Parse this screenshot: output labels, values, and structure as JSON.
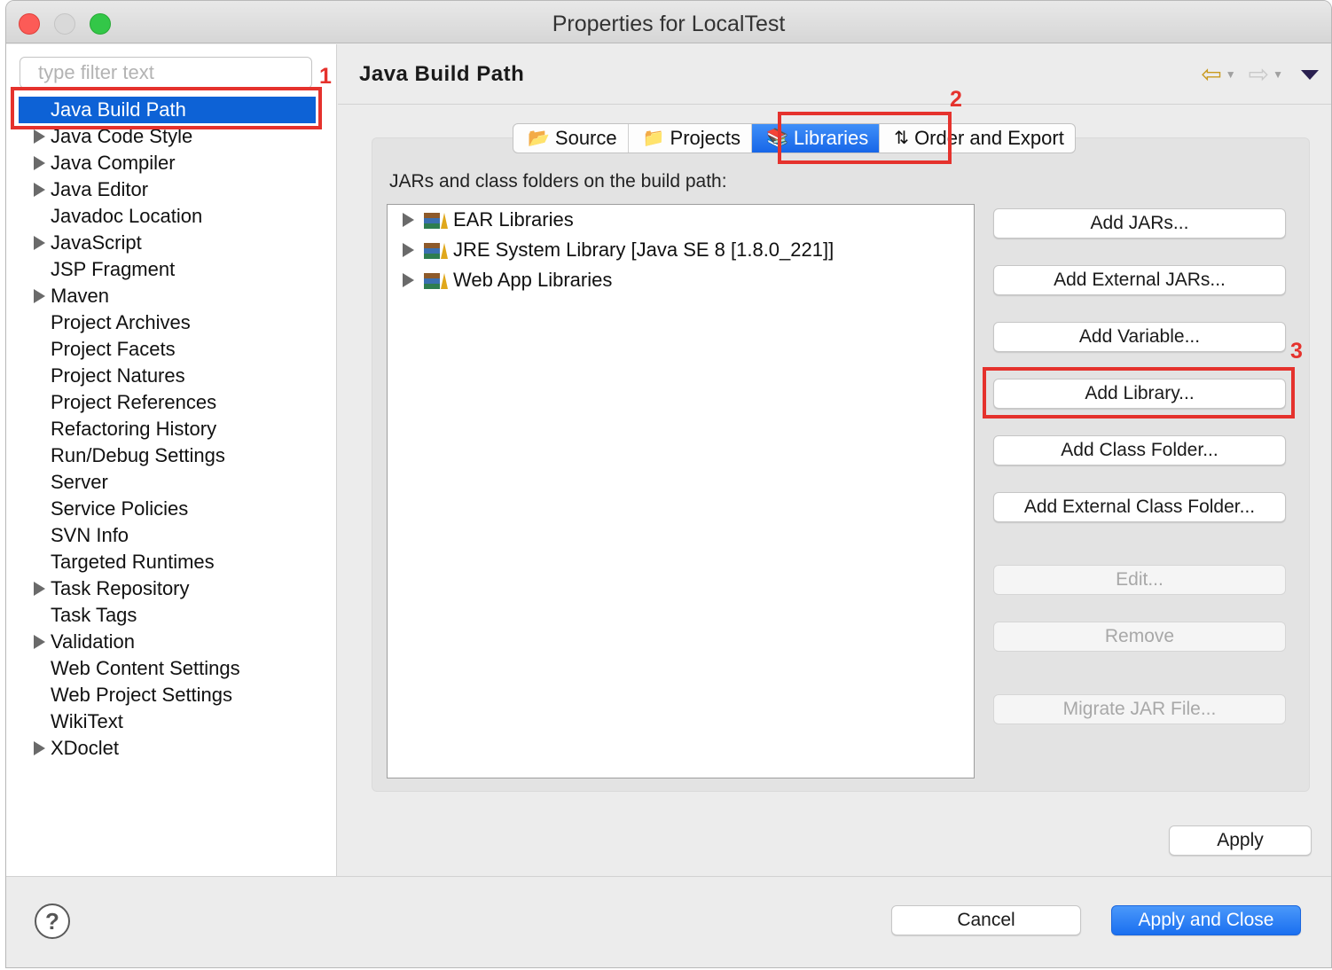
{
  "window": {
    "title": "Properties for LocalTest"
  },
  "filter": {
    "placeholder": "type filter text"
  },
  "tree": [
    {
      "label": "Java Build Path",
      "expandable": false,
      "selected": true
    },
    {
      "label": "Java Code Style",
      "expandable": true
    },
    {
      "label": "Java Compiler",
      "expandable": true
    },
    {
      "label": "Java Editor",
      "expandable": true
    },
    {
      "label": "Javadoc Location",
      "expandable": false
    },
    {
      "label": "JavaScript",
      "expandable": true
    },
    {
      "label": "JSP Fragment",
      "expandable": false
    },
    {
      "label": "Maven",
      "expandable": true
    },
    {
      "label": "Project Archives",
      "expandable": false
    },
    {
      "label": "Project Facets",
      "expandable": false
    },
    {
      "label": "Project Natures",
      "expandable": false
    },
    {
      "label": "Project References",
      "expandable": false
    },
    {
      "label": "Refactoring History",
      "expandable": false
    },
    {
      "label": "Run/Debug Settings",
      "expandable": false
    },
    {
      "label": "Server",
      "expandable": false
    },
    {
      "label": "Service Policies",
      "expandable": false
    },
    {
      "label": "SVN Info",
      "expandable": false
    },
    {
      "label": "Targeted Runtimes",
      "expandable": false
    },
    {
      "label": "Task Repository",
      "expandable": true
    },
    {
      "label": "Task Tags",
      "expandable": false
    },
    {
      "label": "Validation",
      "expandable": true
    },
    {
      "label": "Web Content Settings",
      "expandable": false
    },
    {
      "label": "Web Project Settings",
      "expandable": false
    },
    {
      "label": "WikiText",
      "expandable": false
    },
    {
      "label": "XDoclet",
      "expandable": true
    }
  ],
  "page": {
    "title": "Java Build Path"
  },
  "tabs": [
    {
      "label": "Source",
      "icon": "source-folder-icon"
    },
    {
      "label": "Projects",
      "icon": "projects-folder-icon"
    },
    {
      "label": "Libraries",
      "icon": "libraries-icon",
      "active": true
    },
    {
      "label": "Order and Export",
      "icon": "order-export-icon"
    }
  ],
  "libraries": {
    "label": "JARs and class folders on the build path:",
    "items": [
      {
        "label": "EAR Libraries"
      },
      {
        "label": "JRE System Library [Java SE 8 [1.8.0_221]]"
      },
      {
        "label": "Web App Libraries"
      }
    ]
  },
  "buttons": {
    "add_jars": "Add JARs...",
    "add_external_jars": "Add External JARs...",
    "add_variable": "Add Variable...",
    "add_library": "Add Library...",
    "add_class_folder": "Add Class Folder...",
    "add_external_class_folder": "Add External Class Folder...",
    "edit": "Edit...",
    "remove": "Remove",
    "migrate_jar": "Migrate JAR File...",
    "apply": "Apply",
    "cancel": "Cancel",
    "apply_and_close": "Apply and Close",
    "help": "?"
  },
  "annotations": {
    "step1": "1",
    "step2": "2",
    "step3": "3"
  },
  "colors": {
    "selection": "#0d62d6",
    "annotation": "#e5322d",
    "primary_button": "#1a6ff0"
  }
}
